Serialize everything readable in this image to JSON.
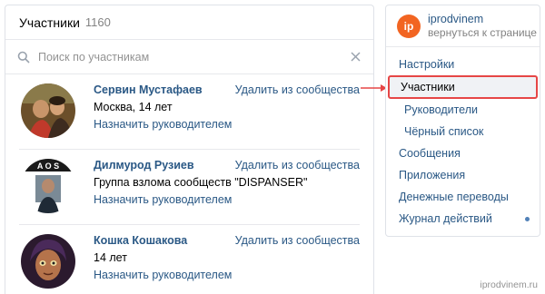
{
  "members_panel": {
    "title": "Участники",
    "count": "1160",
    "search_placeholder": "Поиск по участникам",
    "members": [
      {
        "name": "Сервин Мустафаев",
        "desc": "Москва, 14 лет",
        "assign": "Назначить руководителем",
        "remove": "Удалить из сообщества"
      },
      {
        "name": "Дилмурод Рузиев",
        "desc": "Группа взлома сообществ \"DISPANSER\"",
        "assign": "Назначить руководителем",
        "remove": "Удалить из сообщества"
      },
      {
        "name": "Кошка Кошакова",
        "desc": "14 лет",
        "assign": "Назначить руководителем",
        "remove": "Удалить из сообщества"
      }
    ]
  },
  "nav_panel": {
    "group_logo": "ip",
    "group_name": "iprodvinem",
    "group_back": "вернуться к странице",
    "items": [
      {
        "label": "Настройки"
      },
      {
        "label": "Участники"
      },
      {
        "label": "Руководители"
      },
      {
        "label": "Чёрный список"
      },
      {
        "label": "Сообщения"
      },
      {
        "label": "Приложения"
      },
      {
        "label": "Денежные переводы"
      },
      {
        "label": "Журнал действий"
      }
    ]
  },
  "watermark": "iprodvinem.ru",
  "colors": {
    "link": "#2a5885",
    "highlight": "#e64646",
    "logo": "#f26522"
  }
}
